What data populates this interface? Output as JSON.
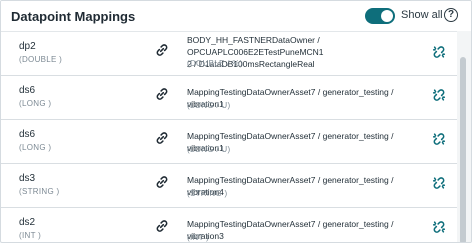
{
  "header": {
    "title": "Datapoint Mappings",
    "show_all_label": "Show all",
    "show_all_on": true,
    "help_label": "?"
  },
  "colors": {
    "accent": "#0e6e7b",
    "muted_text": "#7d8a94",
    "text": "#24313a"
  },
  "rows": [
    {
      "datapoint": "dp2",
      "datapoint_type": "(DOUBLE )",
      "source_line1": "BODY_HH_FASTNERDataOwner / OPCUAPLC006E2ETestPuneMCN1",
      "source_line2": "2 / D1ataDB100msRectangleReal",
      "source_type": "(DOUBLE / %)",
      "link_icon": "link-icon",
      "action_icon": "unlink-icon"
    },
    {
      "datapoint": "ds6",
      "datapoint_type": "(LONG )",
      "source_line1": "MappingTestingDataOwnerAsset7 / generator_testing / vibration1",
      "source_line2": "",
      "source_type": "(LONG / U)",
      "link_icon": "link-icon",
      "action_icon": "unlink-icon"
    },
    {
      "datapoint": "ds6",
      "datapoint_type": "(LONG )",
      "source_line1": "MappingTestingDataOwnerAsset7 / generator_testing / vibration1",
      "source_line2": "",
      "source_type": "(LONG / U)",
      "link_icon": "link-icon",
      "action_icon": "unlink-icon"
    },
    {
      "datapoint": "ds3",
      "datapoint_type": "(STRING )",
      "source_line1": "MappingTestingDataOwnerAsset7 / generator_testing / vibration4",
      "source_line2": "",
      "source_type": "(STRING )",
      "link_icon": "link-icon",
      "action_icon": "unlink-icon"
    },
    {
      "datapoint": "ds2",
      "datapoint_type": "(INT )",
      "source_line1": "MappingTestingDataOwnerAsset7 / generator_testing / vibration3",
      "source_line2": "",
      "source_type": "(INT )",
      "link_icon": "link-icon",
      "action_icon": "unlink-icon"
    }
  ]
}
